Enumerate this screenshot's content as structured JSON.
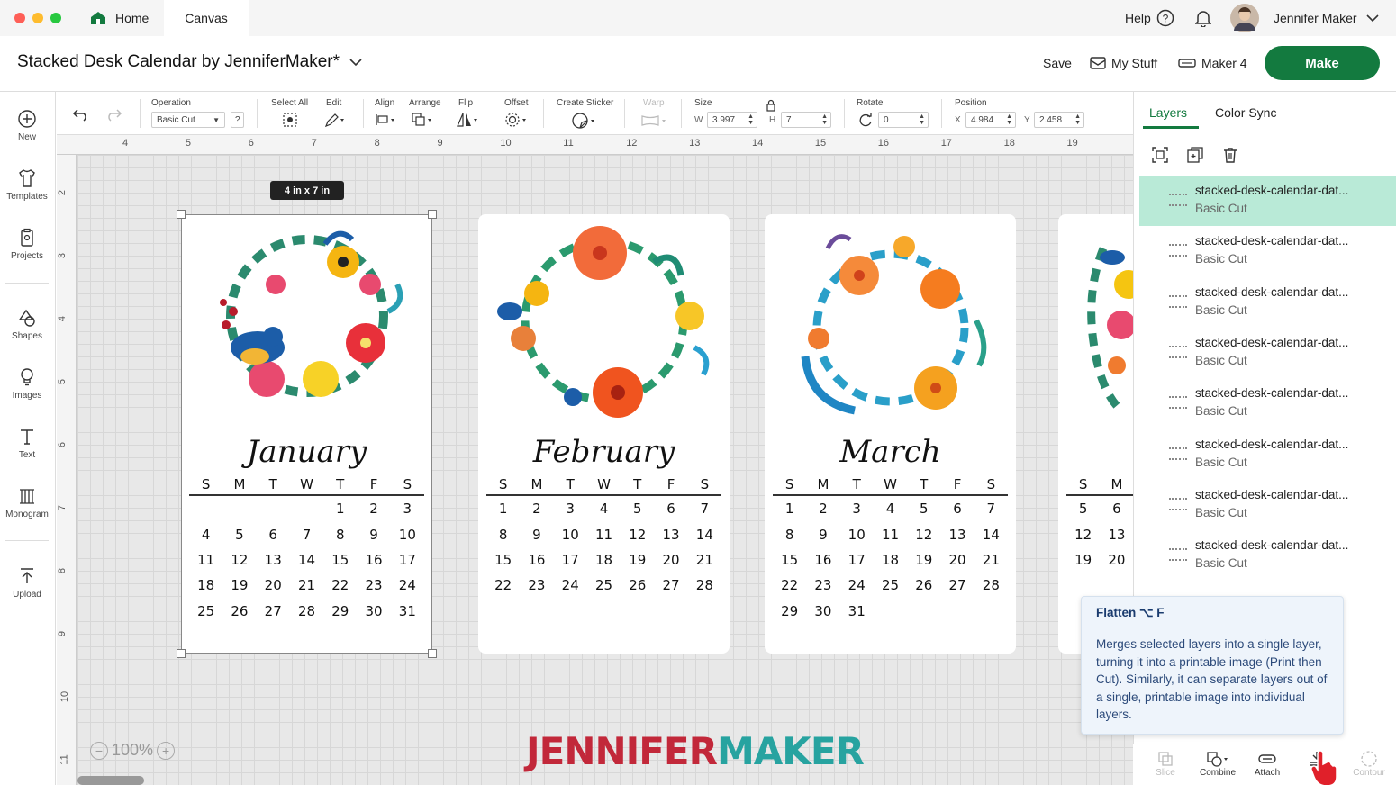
{
  "titlebar": {
    "tabs": [
      {
        "label": "Home"
      },
      {
        "label": "Canvas"
      }
    ],
    "help_label": "Help",
    "user_name": "Jennifer Maker"
  },
  "header": {
    "project_title": "Stacked Desk Calendar by JenniferMaker*",
    "save_label": "Save",
    "mystuff_label": "My Stuff",
    "machine_label": "Maker 4",
    "make_label": "Make"
  },
  "sidebar": {
    "items": [
      {
        "label": "New",
        "icon": "plus-circle-icon"
      },
      {
        "label": "Templates",
        "icon": "shirt-icon"
      },
      {
        "label": "Projects",
        "icon": "clipboard-icon"
      },
      {
        "label": "Shapes",
        "icon": "shapes-icon"
      },
      {
        "label": "Images",
        "icon": "lightbulb-icon"
      },
      {
        "label": "Text",
        "icon": "text-icon"
      },
      {
        "label": "Monogram",
        "icon": "monogram-icon"
      },
      {
        "label": "Upload",
        "icon": "upload-icon"
      }
    ]
  },
  "toolbar": {
    "operation_label": "Operation",
    "operation_value": "Basic Cut",
    "help_q": "?",
    "select_all_label": "Select All",
    "edit_label": "Edit",
    "align_label": "Align",
    "arrange_label": "Arrange",
    "flip_label": "Flip",
    "offset_label": "Offset",
    "create_sticker_label": "Create Sticker",
    "warp_label": "Warp",
    "size_label": "Size",
    "w_label": "W",
    "w_value": "3.997",
    "h_label": "H",
    "h_value": "7",
    "rotate_label": "Rotate",
    "rotate_value": "0",
    "position_label": "Position",
    "x_label": "X",
    "x_value": "4.984",
    "y_label": "Y",
    "y_value": "2.458"
  },
  "ruler": {
    "top_numbers": [
      "4",
      "5",
      "6",
      "7",
      "8",
      "9",
      "10",
      "11",
      "12",
      "13",
      "14",
      "15",
      "16",
      "17",
      "18",
      "19"
    ],
    "left_numbers": [
      "2",
      "3",
      "4",
      "5",
      "6",
      "7",
      "8",
      "9",
      "10",
      "11"
    ]
  },
  "canvas": {
    "size_tag": "4 in x 7 in",
    "zoom_value": "100%",
    "zoom_minus": "−",
    "zoom_plus": "+",
    "brand_part1": "JENNIFER",
    "brand_part2": "MAKER",
    "brand_color1": "#c2283a",
    "brand_color2": "#27a3a0",
    "weekdays": [
      "S",
      "M",
      "T",
      "W",
      "T",
      "F",
      "S"
    ],
    "cards": [
      {
        "month": "January",
        "rows": [
          [
            "",
            "",
            "",
            "",
            "1",
            "2",
            "3"
          ],
          [
            "4",
            "5",
            "6",
            "7",
            "8",
            "9",
            "10"
          ],
          [
            "11",
            "12",
            "13",
            "14",
            "15",
            "16",
            "17"
          ],
          [
            "18",
            "19",
            "20",
            "21",
            "22",
            "23",
            "24"
          ],
          [
            "25",
            "26",
            "27",
            "28",
            "29",
            "30",
            "31"
          ]
        ]
      },
      {
        "month": "February",
        "rows": [
          [
            "1",
            "2",
            "3",
            "4",
            "5",
            "6",
            "7"
          ],
          [
            "8",
            "9",
            "10",
            "11",
            "12",
            "13",
            "14"
          ],
          [
            "15",
            "16",
            "17",
            "18",
            "19",
            "20",
            "21"
          ],
          [
            "22",
            "23",
            "24",
            "25",
            "26",
            "27",
            "28"
          ],
          [
            "",
            "",
            "",
            "",
            "",
            "",
            ""
          ]
        ]
      },
      {
        "month": "March",
        "rows": [
          [
            "1",
            "2",
            "3",
            "4",
            "5",
            "6",
            "7"
          ],
          [
            "8",
            "9",
            "10",
            "11",
            "12",
            "13",
            "14"
          ],
          [
            "15",
            "16",
            "17",
            "18",
            "19",
            "20",
            "21"
          ],
          [
            "22",
            "23",
            "24",
            "25",
            "26",
            "27",
            "28"
          ],
          [
            "29",
            "30",
            "31",
            "",
            "",
            "",
            ""
          ]
        ]
      }
    ],
    "partial_card": {
      "weekdays": [
        "S",
        "M"
      ],
      "rows": [
        [
          "5",
          "6"
        ],
        [
          "12",
          "13"
        ],
        [
          "19",
          "20"
        ]
      ]
    }
  },
  "right_panel": {
    "tabs": [
      {
        "label": "Layers"
      },
      {
        "label": "Color Sync"
      }
    ],
    "layers": [
      {
        "name": "stacked-desk-calendar-dat...",
        "op": "Basic Cut"
      },
      {
        "name": "stacked-desk-calendar-dat...",
        "op": "Basic Cut"
      },
      {
        "name": "stacked-desk-calendar-dat...",
        "op": "Basic Cut"
      },
      {
        "name": "stacked-desk-calendar-dat...",
        "op": "Basic Cut"
      },
      {
        "name": "stacked-desk-calendar-dat...",
        "op": "Basic Cut"
      },
      {
        "name": "stacked-desk-calendar-dat...",
        "op": "Basic Cut"
      },
      {
        "name": "stacked-desk-calendar-dat...",
        "op": "Basic Cut"
      },
      {
        "name": "stacked-desk-calendar-dat...",
        "op": "Basic Cut"
      }
    ],
    "tooltip": {
      "title": "Flatten ⌥ F",
      "body": "Merges selected layers into a single layer, turning it into a printable image (Print then Cut). Similarly, it can separate layers out of a single, printable image into individual layers."
    },
    "bottom_tools": [
      {
        "label": "Slice",
        "enabled": false
      },
      {
        "label": "Combine",
        "enabled": true
      },
      {
        "label": "Attach",
        "enabled": true
      },
      {
        "label": "Fl",
        "enabled": true
      },
      {
        "label": "Contour",
        "enabled": false
      }
    ]
  },
  "colors": {
    "accent_green": "#137a3f",
    "layer_selected": "#b9ead7",
    "tab_active": "#137a3f"
  }
}
